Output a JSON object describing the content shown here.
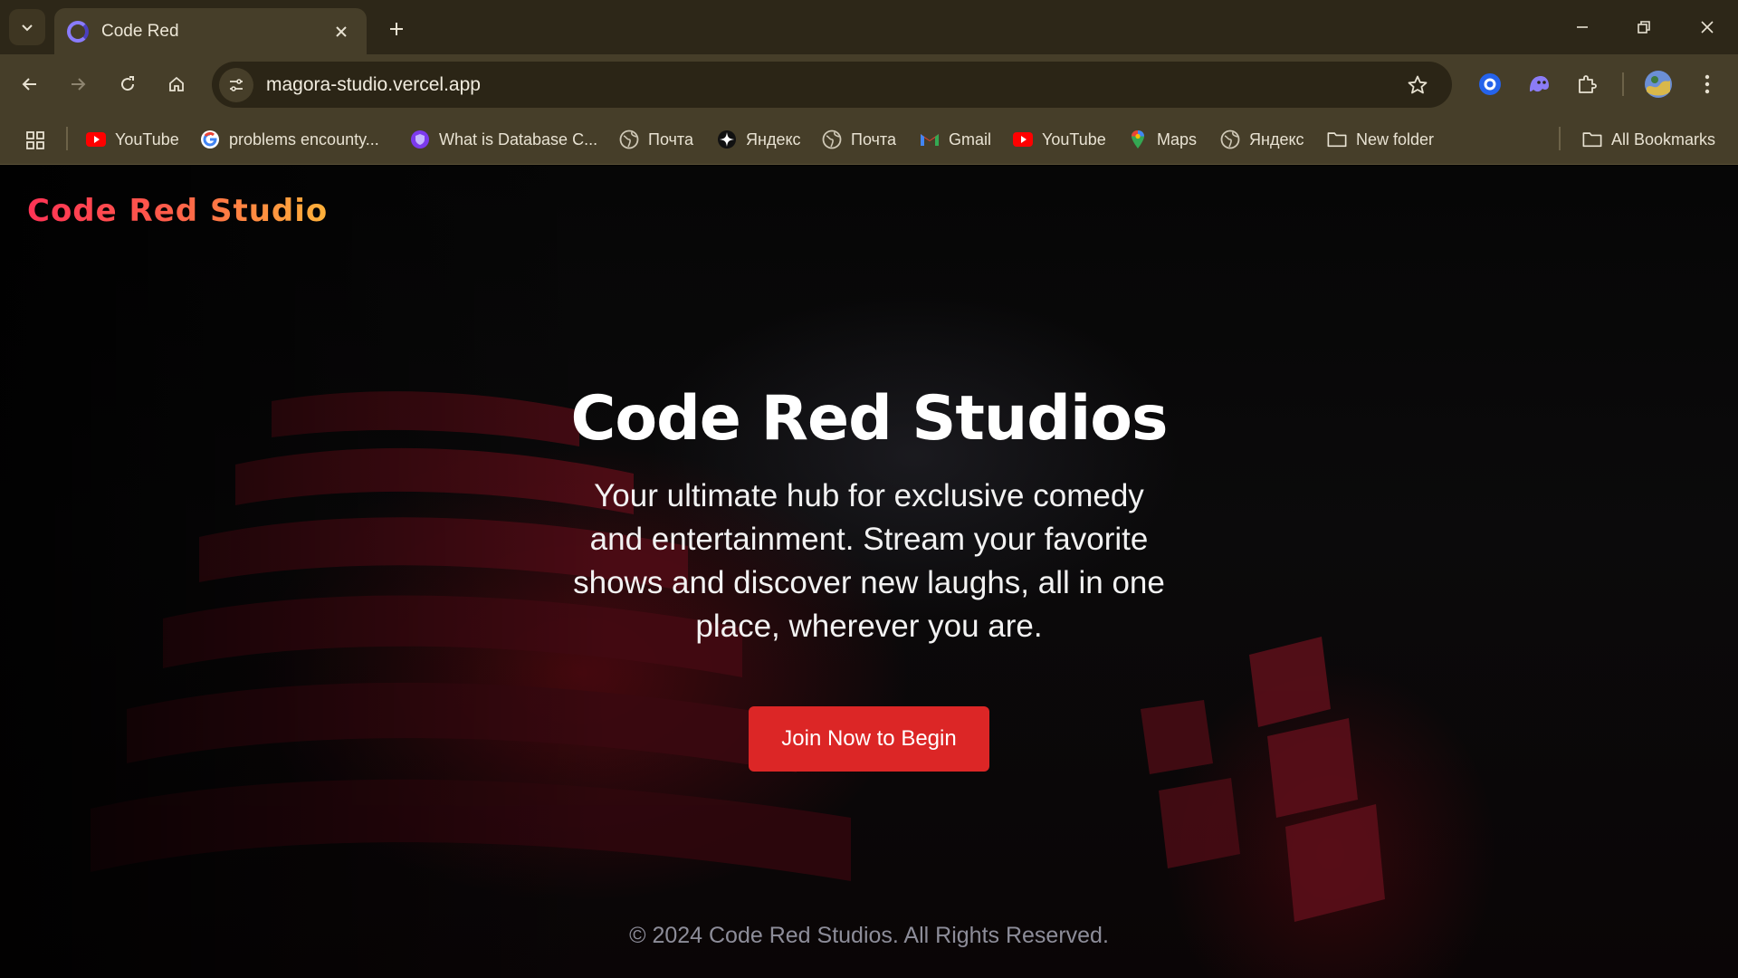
{
  "browser": {
    "tab": {
      "title": "Code Red"
    },
    "address_bar": {
      "url": "magora-studio.vercel.app"
    },
    "bookmarks": [
      {
        "label": "YouTube",
        "icon": "youtube-icon"
      },
      {
        "label": "problems encounty...",
        "icon": "google-icon"
      },
      {
        "label": "What is Database C...",
        "icon": "shield-icon"
      },
      {
        "label": "Почта",
        "icon": "globe-icon"
      },
      {
        "label": "Яндекс",
        "icon": "spark-icon"
      },
      {
        "label": "Почта",
        "icon": "globe-icon"
      },
      {
        "label": "Gmail",
        "icon": "gmail-icon"
      },
      {
        "label": "YouTube",
        "icon": "youtube-icon"
      },
      {
        "label": "Maps",
        "icon": "maps-pin-icon"
      },
      {
        "label": "Яндекс",
        "icon": "globe-icon"
      },
      {
        "label": "New folder",
        "icon": "folder-icon"
      }
    ],
    "all_bookmarks_label": "All Bookmarks"
  },
  "page": {
    "logo": "Code Red Studio",
    "hero": {
      "title": "Code Red Studios",
      "subtitle": "Your ultimate hub for exclusive comedy and entertainment. Stream your favorite shows and discover new laughs, all in one place, wherever you are.",
      "cta_label": "Join Now to Begin"
    },
    "footer": "© 2024 Code Red Studios. All Rights Reserved."
  },
  "colors": {
    "accent": "#dc2626",
    "chrome_dark": "#2d2718",
    "chrome": "#463e29",
    "logo_gradient_start": "#ff3355",
    "logo_gradient_end": "#ffb23a"
  }
}
